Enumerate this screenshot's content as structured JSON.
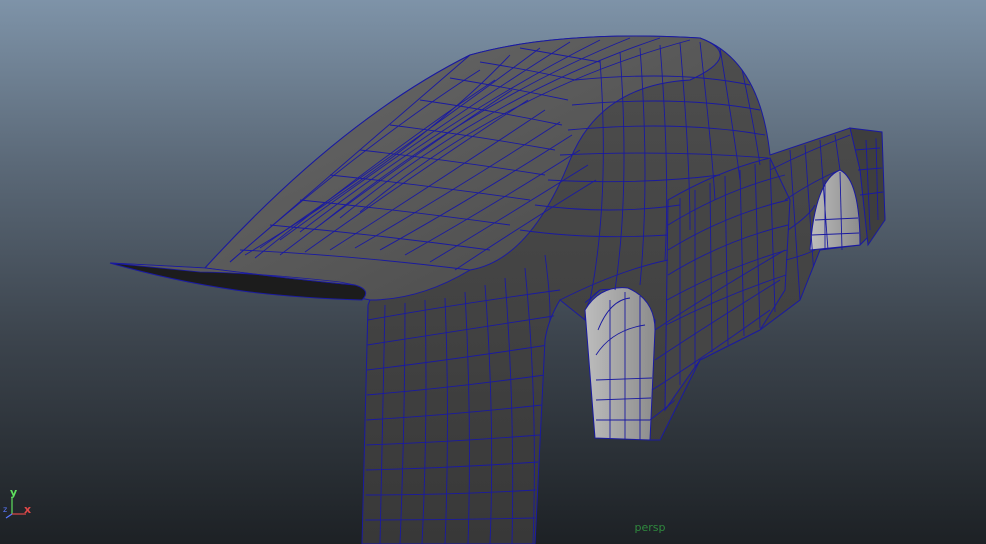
{
  "viewport": {
    "camera_name": "persp",
    "model": "car-body-mesh"
  },
  "axes": {
    "y_label": "y",
    "x_label": "x",
    "z_label": "z"
  },
  "colors": {
    "background_top": "#7e93a8",
    "background_bottom": "#1d2125",
    "mesh_surface": "#4a4a4a",
    "wireframe": "#1a1aa0",
    "camera_label": "#2f8a3e",
    "axis_x": "#e04848",
    "axis_y": "#5ee05e",
    "axis_z": "#5a78ff"
  }
}
